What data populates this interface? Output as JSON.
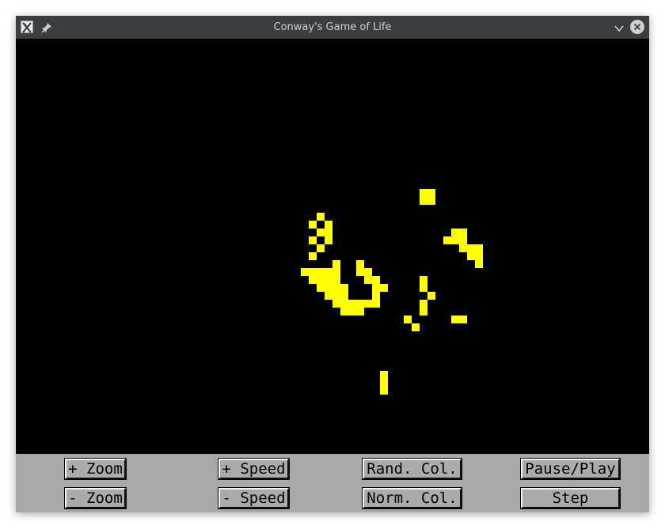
{
  "window": {
    "title": "Conway's Game of Life"
  },
  "colors": {
    "cell": "#ffff00",
    "background": "#000000",
    "panel": "#a8a8a8",
    "titlebar": "#3b3e41"
  },
  "icons": {
    "app": "x-app-icon",
    "pin": "pin-icon",
    "minimize": "chevron-down-icon",
    "close": "close-icon"
  },
  "controls": {
    "zoom_in": "+ Zoom",
    "zoom_out": "- Zoom",
    "speed_up": "+ Speed",
    "speed_down": "- Speed",
    "random_color": "Rand. Col.",
    "normal_color": "Norm. Col.",
    "pause_play": "Pause/Play",
    "step": "Step"
  },
  "grid": {
    "cell_size": 10,
    "live_cells": [
      [
        51,
        19
      ],
      [
        52,
        19
      ],
      [
        51,
        20
      ],
      [
        52,
        20
      ],
      [
        38,
        22
      ],
      [
        37,
        23
      ],
      [
        39,
        23
      ],
      [
        38,
        24
      ],
      [
        39,
        24
      ],
      [
        55,
        24
      ],
      [
        56,
        24
      ],
      [
        37,
        25
      ],
      [
        39,
        25
      ],
      [
        54,
        25
      ],
      [
        55,
        25
      ],
      [
        56,
        25
      ],
      [
        38,
        26
      ],
      [
        56,
        26
      ],
      [
        57,
        26
      ],
      [
        58,
        26
      ],
      [
        37,
        27
      ],
      [
        57,
        27
      ],
      [
        58,
        27
      ],
      [
        40,
        28
      ],
      [
        43,
        28
      ],
      [
        58,
        28
      ],
      [
        36,
        29
      ],
      [
        37,
        29
      ],
      [
        38,
        29
      ],
      [
        39,
        29
      ],
      [
        40,
        29
      ],
      [
        43,
        29
      ],
      [
        44,
        29
      ],
      [
        37,
        30
      ],
      [
        38,
        30
      ],
      [
        39,
        30
      ],
      [
        40,
        30
      ],
      [
        44,
        30
      ],
      [
        45,
        30
      ],
      [
        51,
        30
      ],
      [
        38,
        31
      ],
      [
        39,
        31
      ],
      [
        40,
        31
      ],
      [
        41,
        31
      ],
      [
        45,
        31
      ],
      [
        46,
        31
      ],
      [
        51,
        31
      ],
      [
        39,
        32
      ],
      [
        40,
        32
      ],
      [
        41,
        32
      ],
      [
        45,
        32
      ],
      [
        52,
        32
      ],
      [
        40,
        33
      ],
      [
        41,
        33
      ],
      [
        42,
        33
      ],
      [
        43,
        33
      ],
      [
        44,
        33
      ],
      [
        45,
        33
      ],
      [
        51,
        33
      ],
      [
        41,
        34
      ],
      [
        42,
        34
      ],
      [
        43,
        34
      ],
      [
        51,
        34
      ],
      [
        49,
        35
      ],
      [
        55,
        35
      ],
      [
        56,
        35
      ],
      [
        50,
        36
      ],
      [
        46,
        42
      ],
      [
        46,
        43
      ],
      [
        46,
        44
      ]
    ]
  }
}
